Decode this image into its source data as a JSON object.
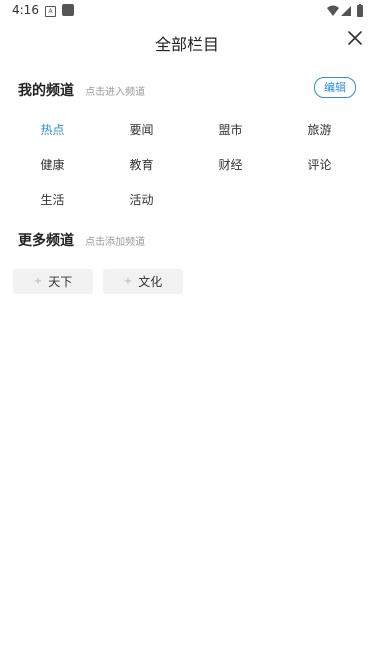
{
  "status_bar": {
    "time": "4:16",
    "notif_icon_letter": "A",
    "icons": [
      "wifi-icon",
      "signal-icon",
      "battery-icon"
    ]
  },
  "header": {
    "title": "全部栏目",
    "close_icon": "close-icon"
  },
  "my_channels": {
    "title": "我的频道",
    "hint": "点击进入频道",
    "edit_label": "编辑",
    "rows": [
      [
        "热点",
        "要闻",
        "盟市",
        "旅游"
      ],
      [
        "健康",
        "教育",
        "财经",
        "评论"
      ],
      [
        "生活",
        "活动"
      ]
    ],
    "active": "热点"
  },
  "more_channels": {
    "title": "更多频道",
    "hint": "点击添加频道",
    "items": [
      {
        "plus": "+",
        "label": "天下"
      },
      {
        "plus": "+",
        "label": "文化"
      }
    ]
  },
  "colors": {
    "accent": "#2f8fd8",
    "chip_bg": "#f2f2f2",
    "hint_text": "#9a9a9a"
  }
}
